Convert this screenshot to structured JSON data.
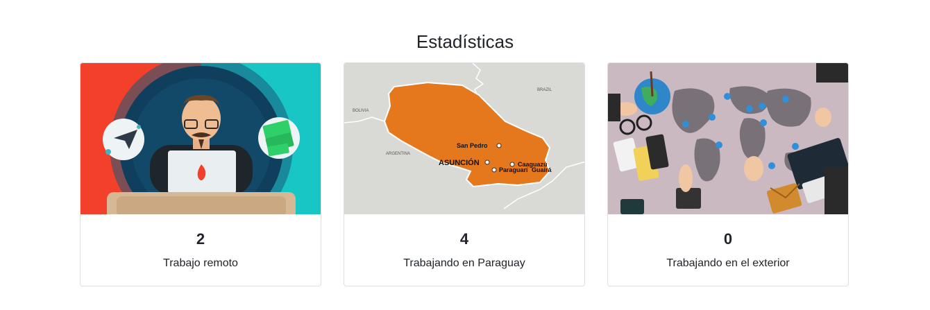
{
  "section": {
    "title": "Estadísticas"
  },
  "cards": [
    {
      "value": "2",
      "label": "Trabajo remoto"
    },
    {
      "value": "4",
      "label": "Trabajando en Paraguay"
    },
    {
      "value": "0",
      "label": "Trabajando en el exterior"
    }
  ],
  "map": {
    "places": [
      "BOLIVIA",
      "BRAZIL",
      "ARGENTINA",
      "San Pedro",
      "ASUNCIÓN",
      "Caaguazú",
      "Paraguarí",
      "Guairá"
    ]
  },
  "colors": {
    "remote_bg_left": "#f2402a",
    "remote_bg_right": "#18c6c6",
    "paraguay_fill": "#e5781c",
    "map_bg": "#d9d9d6",
    "world_bg": "#cbb9c2"
  }
}
